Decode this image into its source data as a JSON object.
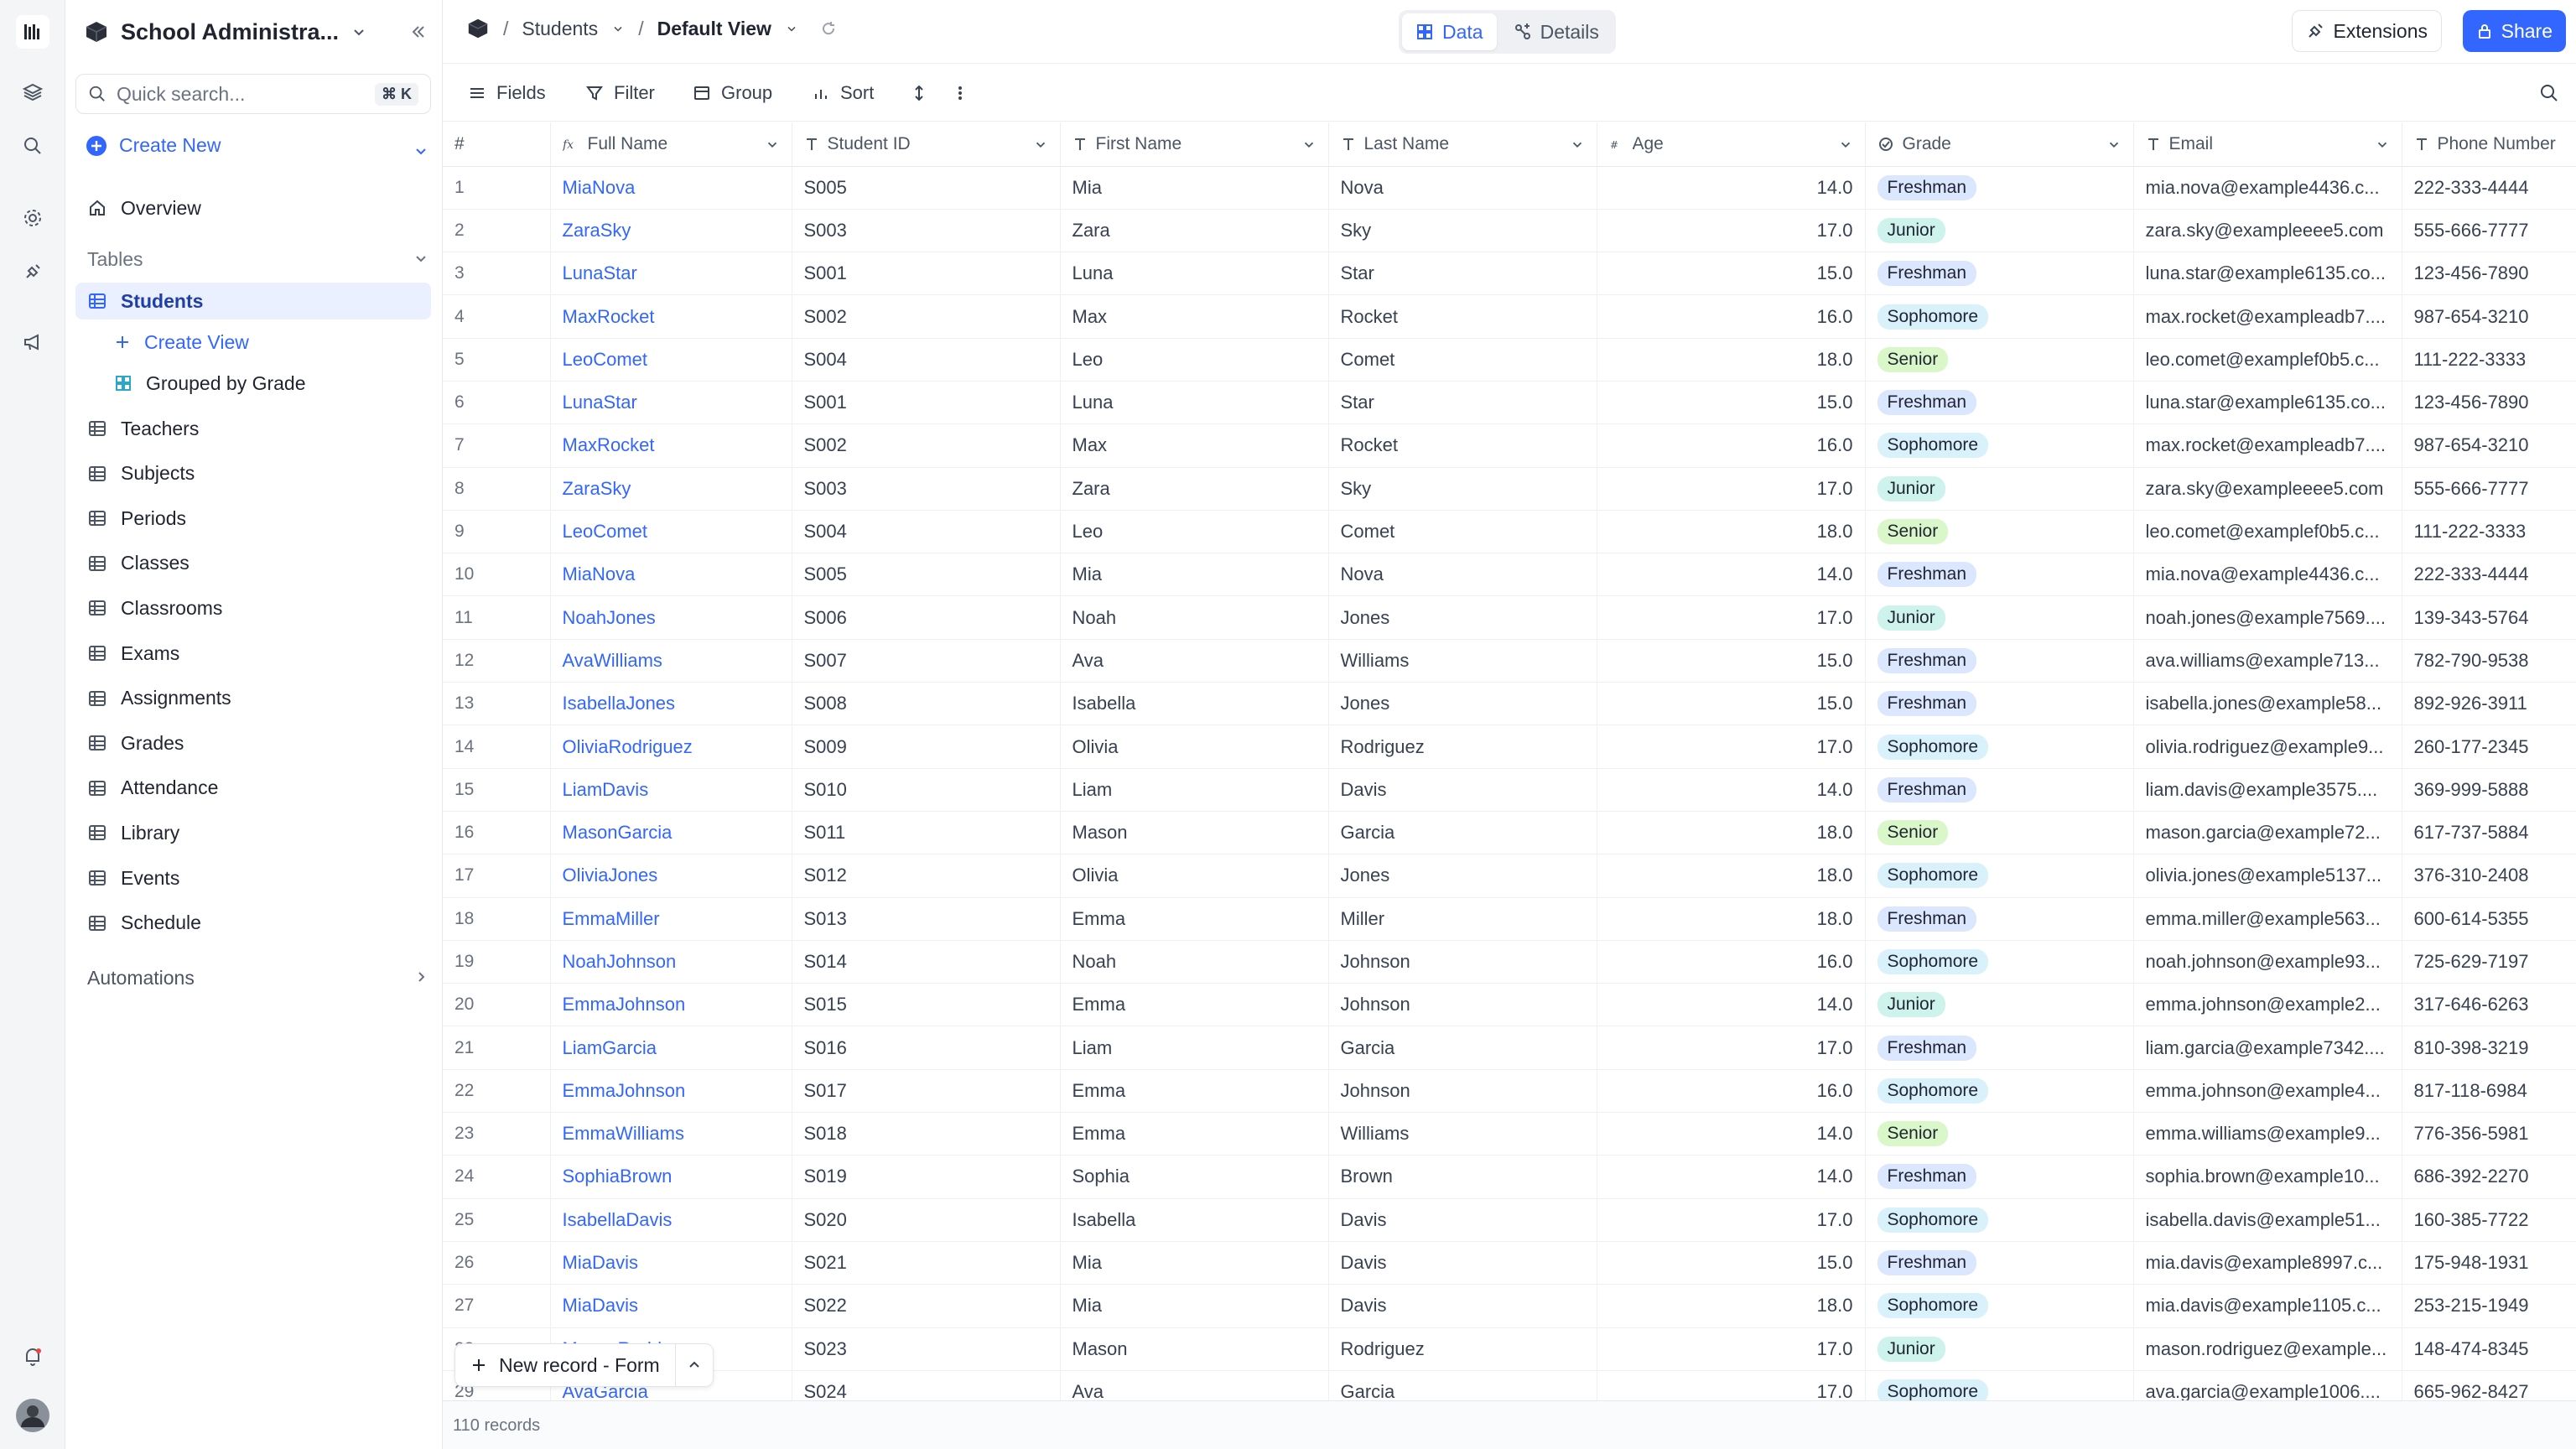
{
  "workspace": {
    "name": "School Administra..."
  },
  "search": {
    "placeholder": "Quick search...",
    "shortcut": "⌘ K"
  },
  "sidebar": {
    "create_new": "Create New",
    "overview": "Overview",
    "tables_label": "Tables",
    "create_view": "Create View",
    "grouped_view": "Grouped by Grade",
    "tables": [
      "Students",
      "Teachers",
      "Subjects",
      "Periods",
      "Classes",
      "Classrooms",
      "Exams",
      "Assignments",
      "Grades",
      "Attendance",
      "Library",
      "Events",
      "Schedule"
    ],
    "automations_label": "Automations"
  },
  "breadcrumb": {
    "table": "Students",
    "view": "Default View"
  },
  "view_tabs": {
    "data": "Data",
    "details": "Details"
  },
  "header_actions": {
    "extensions": "Extensions",
    "share": "Share"
  },
  "toolbar": {
    "fields": "Fields",
    "filter": "Filter",
    "group": "Group",
    "sort": "Sort"
  },
  "columns": [
    "#",
    "Full Name",
    "Student ID",
    "First Name",
    "Last Name",
    "Age",
    "Grade",
    "Email",
    "Phone Number"
  ],
  "grade_colors": {
    "Freshman": "#dbe6ff",
    "Junior": "#cdf3ec",
    "Sophomore": "#d8f1fb",
    "Senior": "#d9f7c9"
  },
  "rows": [
    [
      "1",
      "MiaNova",
      "S005",
      "Mia",
      "Nova",
      "14.0",
      "Freshman",
      "mia.nova@example4436.c...",
      "222-333-4444"
    ],
    [
      "2",
      "ZaraSky",
      "S003",
      "Zara",
      "Sky",
      "17.0",
      "Junior",
      "zara.sky@exampleeee5.com",
      "555-666-7777"
    ],
    [
      "3",
      "LunaStar",
      "S001",
      "Luna",
      "Star",
      "15.0",
      "Freshman",
      "luna.star@example6135.co...",
      "123-456-7890"
    ],
    [
      "4",
      "MaxRocket",
      "S002",
      "Max",
      "Rocket",
      "16.0",
      "Sophomore",
      "max.rocket@exampleadb7....",
      "987-654-3210"
    ],
    [
      "5",
      "LeoComet",
      "S004",
      "Leo",
      "Comet",
      "18.0",
      "Senior",
      "leo.comet@examplef0b5.c...",
      "111-222-3333"
    ],
    [
      "6",
      "LunaStar",
      "S001",
      "Luna",
      "Star",
      "15.0",
      "Freshman",
      "luna.star@example6135.co...",
      "123-456-7890"
    ],
    [
      "7",
      "MaxRocket",
      "S002",
      "Max",
      "Rocket",
      "16.0",
      "Sophomore",
      "max.rocket@exampleadb7....",
      "987-654-3210"
    ],
    [
      "8",
      "ZaraSky",
      "S003",
      "Zara",
      "Sky",
      "17.0",
      "Junior",
      "zara.sky@exampleeee5.com",
      "555-666-7777"
    ],
    [
      "9",
      "LeoComet",
      "S004",
      "Leo",
      "Comet",
      "18.0",
      "Senior",
      "leo.comet@examplef0b5.c...",
      "111-222-3333"
    ],
    [
      "10",
      "MiaNova",
      "S005",
      "Mia",
      "Nova",
      "14.0",
      "Freshman",
      "mia.nova@example4436.c...",
      "222-333-4444"
    ],
    [
      "11",
      "NoahJones",
      "S006",
      "Noah",
      "Jones",
      "17.0",
      "Junior",
      "noah.jones@example7569....",
      "139-343-5764"
    ],
    [
      "12",
      "AvaWilliams",
      "S007",
      "Ava",
      "Williams",
      "15.0",
      "Freshman",
      "ava.williams@example713...",
      "782-790-9538"
    ],
    [
      "13",
      "IsabellaJones",
      "S008",
      "Isabella",
      "Jones",
      "15.0",
      "Freshman",
      "isabella.jones@example58...",
      "892-926-3911"
    ],
    [
      "14",
      "OliviaRodriguez",
      "S009",
      "Olivia",
      "Rodriguez",
      "17.0",
      "Sophomore",
      "olivia.rodriguez@example9...",
      "260-177-2345"
    ],
    [
      "15",
      "LiamDavis",
      "S010",
      "Liam",
      "Davis",
      "14.0",
      "Freshman",
      "liam.davis@example3575....",
      "369-999-5888"
    ],
    [
      "16",
      "MasonGarcia",
      "S011",
      "Mason",
      "Garcia",
      "18.0",
      "Senior",
      "mason.garcia@example72...",
      "617-737-5884"
    ],
    [
      "17",
      "OliviaJones",
      "S012",
      "Olivia",
      "Jones",
      "18.0",
      "Sophomore",
      "olivia.jones@example5137...",
      "376-310-2408"
    ],
    [
      "18",
      "EmmaMiller",
      "S013",
      "Emma",
      "Miller",
      "18.0",
      "Freshman",
      "emma.miller@example563...",
      "600-614-5355"
    ],
    [
      "19",
      "NoahJohnson",
      "S014",
      "Noah",
      "Johnson",
      "16.0",
      "Sophomore",
      "noah.johnson@example93...",
      "725-629-7197"
    ],
    [
      "20",
      "EmmaJohnson",
      "S015",
      "Emma",
      "Johnson",
      "14.0",
      "Junior",
      "emma.johnson@example2...",
      "317-646-6263"
    ],
    [
      "21",
      "LiamGarcia",
      "S016",
      "Liam",
      "Garcia",
      "17.0",
      "Freshman",
      "liam.garcia@example7342....",
      "810-398-3219"
    ],
    [
      "22",
      "EmmaJohnson",
      "S017",
      "Emma",
      "Johnson",
      "16.0",
      "Sophomore",
      "emma.johnson@example4...",
      "817-118-6984"
    ],
    [
      "23",
      "EmmaWilliams",
      "S018",
      "Emma",
      "Williams",
      "14.0",
      "Senior",
      "emma.williams@example9...",
      "776-356-5981"
    ],
    [
      "24",
      "SophiaBrown",
      "S019",
      "Sophia",
      "Brown",
      "14.0",
      "Freshman",
      "sophia.brown@example10...",
      "686-392-2270"
    ],
    [
      "25",
      "IsabellaDavis",
      "S020",
      "Isabella",
      "Davis",
      "17.0",
      "Sophomore",
      "isabella.davis@example51...",
      "160-385-7722"
    ],
    [
      "26",
      "MiaDavis",
      "S021",
      "Mia",
      "Davis",
      "15.0",
      "Freshman",
      "mia.davis@example8997.c...",
      "175-948-1931"
    ],
    [
      "27",
      "MiaDavis",
      "S022",
      "Mia",
      "Davis",
      "18.0",
      "Sophomore",
      "mia.davis@example1105.c...",
      "253-215-1949"
    ],
    [
      "28",
      "MasonRodriguez",
      "S023",
      "Mason",
      "Rodriguez",
      "17.0",
      "Junior",
      "mason.rodriguez@example...",
      "148-474-8345"
    ],
    [
      "29",
      "AvaGarcia",
      "S024",
      "Ava",
      "Garcia",
      "17.0",
      "Sophomore",
      "ava.garcia@example1006....",
      "665-962-8427"
    ]
  ],
  "new_record": {
    "label": "New record - Form"
  },
  "footer": {
    "count": "110 records"
  }
}
